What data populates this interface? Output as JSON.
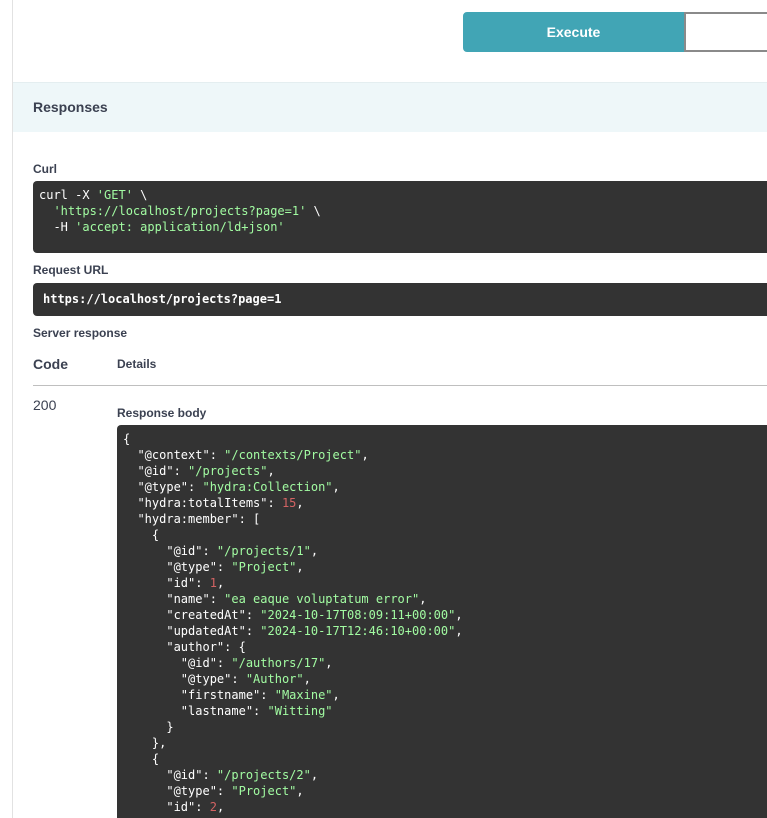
{
  "toolbar": {
    "execute_label": "Execute"
  },
  "responses": {
    "title": "Responses",
    "curl_label": "Curl",
    "curl_lines": [
      {
        "plain": "curl -X ",
        "str": "'GET'",
        "tail": " \\"
      },
      {
        "plain": "  ",
        "str": "'https://localhost/projects?page=1'",
        "tail": " \\"
      },
      {
        "plain": "  -H ",
        "str": "'accept: application/ld+json'",
        "tail": ""
      }
    ],
    "request_url_label": "Request URL",
    "request_url": "https://localhost/projects?page=1",
    "server_response_label": "Server response",
    "columns": {
      "code": "Code",
      "details": "Details"
    },
    "status_code": "200",
    "response_body_label": "Response body",
    "body_lines": [
      {
        "plain": "{"
      },
      {
        "plain": "  \"@context\": ",
        "str": "\"/contexts/Project\"",
        "tail": ","
      },
      {
        "plain": "  \"@id\": ",
        "str": "\"/projects\"",
        "tail": ","
      },
      {
        "plain": "  \"@type\": ",
        "str": "\"hydra:Collection\"",
        "tail": ","
      },
      {
        "plain": "  \"hydra:totalItems\": ",
        "num": "15",
        "tail": ","
      },
      {
        "plain": "  \"hydra:member\": ["
      },
      {
        "plain": "    {"
      },
      {
        "plain": "      \"@id\": ",
        "str": "\"/projects/1\"",
        "tail": ","
      },
      {
        "plain": "      \"@type\": ",
        "str": "\"Project\"",
        "tail": ","
      },
      {
        "plain": "      \"id\": ",
        "num": "1",
        "tail": ","
      },
      {
        "plain": "      \"name\": ",
        "str": "\"ea eaque voluptatum error\"",
        "tail": ","
      },
      {
        "plain": "      \"createdAt\": ",
        "str": "\"2024-10-17T08:09:11+00:00\"",
        "tail": ","
      },
      {
        "plain": "      \"updatedAt\": ",
        "str": "\"2024-10-17T12:46:10+00:00\"",
        "tail": ","
      },
      {
        "plain": "      \"author\": {"
      },
      {
        "plain": "        \"@id\": ",
        "str": "\"/authors/17\"",
        "tail": ","
      },
      {
        "plain": "        \"@type\": ",
        "str": "\"Author\"",
        "tail": ","
      },
      {
        "plain": "        \"firstname\": ",
        "str": "\"Maxine\"",
        "tail": ","
      },
      {
        "plain": "        \"lastname\": ",
        "str": "\"Witting\"",
        "tail": ""
      },
      {
        "plain": "      }"
      },
      {
        "plain": "    },"
      },
      {
        "plain": "    {"
      },
      {
        "plain": "      \"@id\": ",
        "str": "\"/projects/2\"",
        "tail": ","
      },
      {
        "plain": "      \"@type\": ",
        "str": "\"Project\"",
        "tail": ","
      },
      {
        "plain": "      \"id\": ",
        "num": "2",
        "tail": ","
      }
    ]
  },
  "colors": {
    "execute_bg": "#41a5b5",
    "responses_bg": "#eef7f9",
    "code_bg": "#333333",
    "json_string": "#a2fca2",
    "json_number": "#d36363"
  }
}
